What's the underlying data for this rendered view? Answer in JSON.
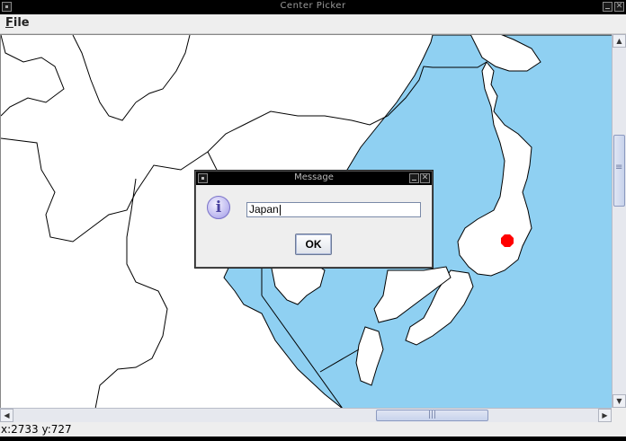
{
  "window": {
    "title": "Center Picker",
    "close_glyph": "✕"
  },
  "menubar": {
    "items": [
      {
        "label": "File"
      }
    ]
  },
  "map": {
    "colors": {
      "sea": "#8fd0f2",
      "land": "#ffffff",
      "border": "#000000",
      "marker": "#ff0000"
    },
    "marker_icon": "red-octagon-marker"
  },
  "scrollbars": {
    "up_glyph": "▲",
    "down_glyph": "▼",
    "left_glyph": "◀",
    "right_glyph": "▶"
  },
  "status": {
    "coords": "x:2733 y:727"
  },
  "dialog": {
    "title": "Message",
    "icon": "information-icon",
    "icon_glyph": "i",
    "input_value": "Japan",
    "ok_label": "OK",
    "close_glyph": "✕"
  }
}
